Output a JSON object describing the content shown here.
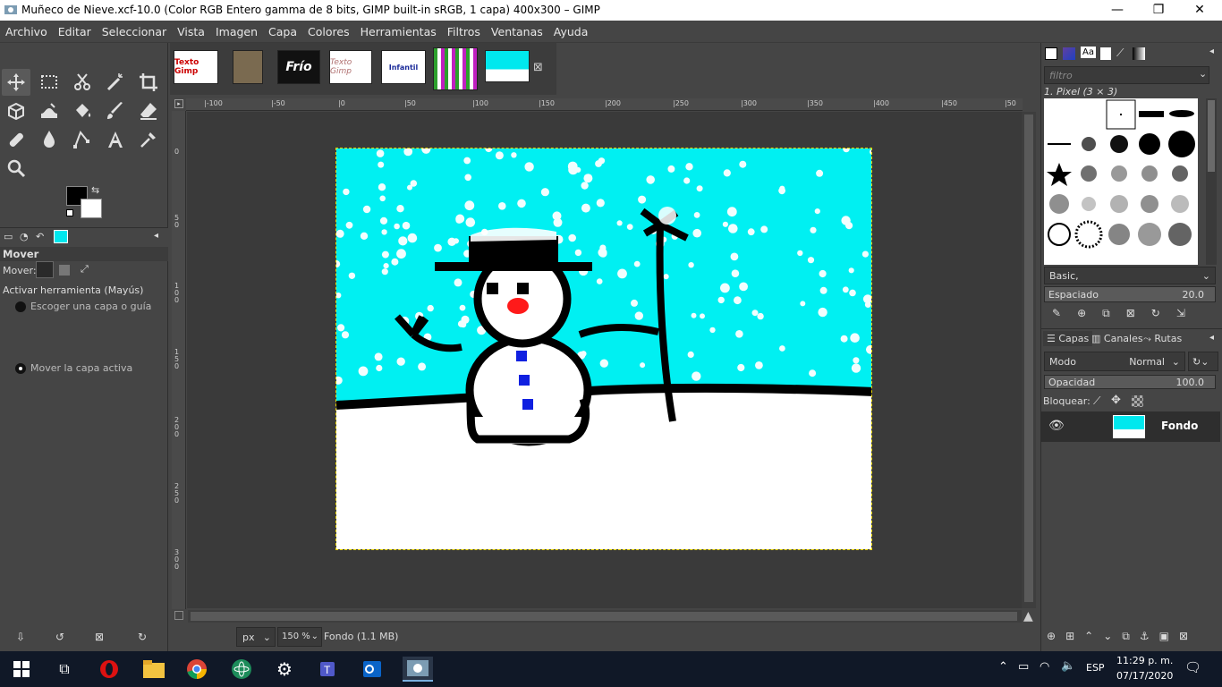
{
  "window": {
    "title": "Muñeco de Nieve.xcf-10.0 (Color RGB Entero gamma de 8 bits, GIMP built-in sRGB, 1 capa) 400x300 – GIMP",
    "min_symbol": "—",
    "max_symbol": "❐",
    "close_symbol": "✕"
  },
  "menu": [
    "Archivo",
    "Editar",
    "Seleccionar",
    "Vista",
    "Imagen",
    "Capa",
    "Colores",
    "Herramientas",
    "Filtros",
    "Ventanas",
    "Ayuda"
  ],
  "image_tabs": {
    "items": [
      {
        "label": "Texto Gimp",
        "color": "#c00000"
      },
      {
        "label": "",
        "color": "#7a6a50"
      },
      {
        "label": "Frío",
        "color": "#ffffff"
      },
      {
        "label": "Texto Gimp",
        "color": "#b07070"
      },
      {
        "label": "Infantil",
        "color": "#1a2a9a"
      },
      {
        "label": "",
        "color": "#2ca02c"
      },
      {
        "label": "",
        "color": "#00e8ee"
      }
    ],
    "close_symbol": "⊠"
  },
  "tool_options": {
    "title": "Mover",
    "mover_label": "Mover:",
    "activate_label": "Activar herramienta  (Mayús)",
    "option_1": "Escoger una capa o guía",
    "option_2": "Mover la capa activa"
  },
  "ruler": {
    "h_labels": [
      "|-100",
      "|-50",
      "|0",
      "|50",
      "|100",
      "|150",
      "|200",
      "|250",
      "|300",
      "|350",
      "|400",
      "|450",
      "|50"
    ],
    "v_labels": [
      "0",
      "5 0",
      "1 0 0",
      "1 5 0",
      "2 0 0",
      "2 5 0",
      "3 0 0"
    ]
  },
  "status": {
    "unit": "px",
    "zoom": "150 %",
    "info": "Fondo (1.1 MB)"
  },
  "brushes": {
    "filter_placeholder": "filtro",
    "brush_name": "1. Pixel (3 × 3)",
    "preset": "Basic,",
    "spacing_label": "Espaciado",
    "spacing_value": "20.0"
  },
  "layers_panel": {
    "tabs": [
      "Capas",
      "Canales",
      "Rutas"
    ],
    "mode_label": "Modo",
    "mode_value": "Normal",
    "opacity_label": "Opacidad",
    "opacity_value": "100.0",
    "lock_label": "Bloquear:",
    "layer_name": "Fondo"
  },
  "taskbar": {
    "lang": "ESP",
    "time": "11:29 p. m.",
    "date": "07/17/2020"
  },
  "colors": {
    "sky": "#00f0f2",
    "snow": "#ffffff",
    "ink": "#000000",
    "nose": "#ff1a1a",
    "buttons": "#1020e0"
  }
}
